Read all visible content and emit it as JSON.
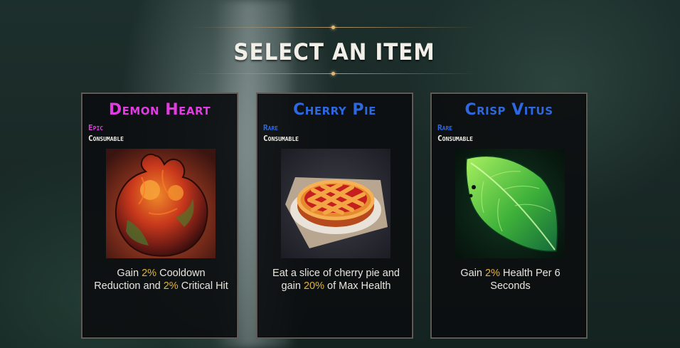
{
  "screen": {
    "title": "SELECT AN ITEM"
  },
  "colors": {
    "epic": "#e23be2",
    "rare": "#2d68e0",
    "highlight": "#e2b33b",
    "text": "#e9e6df",
    "card_border": "#5f5a55"
  },
  "items": [
    {
      "name": "Demon Heart",
      "rarity": "Epic",
      "type": "Consumable",
      "icon": "demon-heart-icon",
      "desc_parts": [
        "Gain ",
        "2%",
        " Cooldown Reduction and ",
        "2%",
        " Critical Hit"
      ]
    },
    {
      "name": "Cherry Pie",
      "rarity": "Rare",
      "type": "Consumable",
      "icon": "cherry-pie-icon",
      "desc_parts": [
        "Eat a slice of cherry pie and gain ",
        "20%",
        " of Max Health"
      ]
    },
    {
      "name": "Crisp Vitus",
      "rarity": "Rare",
      "type": "Consumable",
      "icon": "leaf-icon",
      "desc_parts": [
        "Gain ",
        "2%",
        " Health Per 6 Seconds"
      ]
    }
  ]
}
